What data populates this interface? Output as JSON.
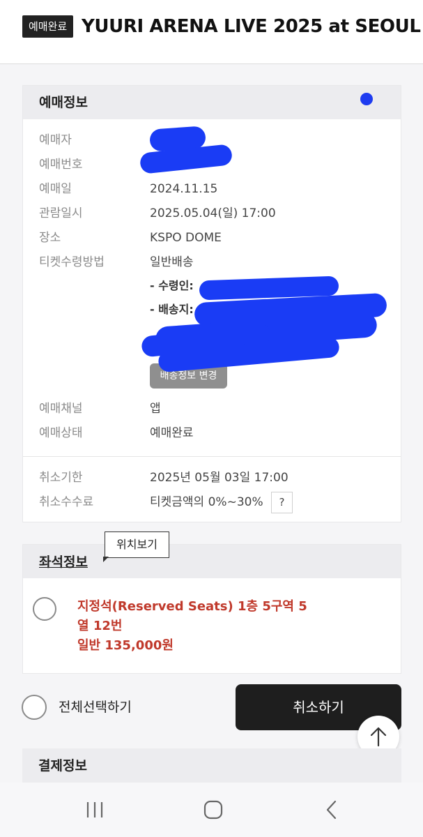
{
  "header": {
    "status_badge": "예매완료",
    "title": "YUURI ARENA LIVE 2025 at SEOUL"
  },
  "booking_info": {
    "section_title": "예매정보",
    "rows": [
      {
        "label": "예매자",
        "value": ""
      },
      {
        "label": "예매번호",
        "value": ""
      },
      {
        "label": "예매일",
        "value": "2024.11.15"
      },
      {
        "label": "관람일시",
        "value": "2025.05.04(일) 17:00"
      },
      {
        "label": "장소",
        "value": "KSPO DOME"
      },
      {
        "label": "티켓수령방법",
        "value": "일반배송"
      }
    ],
    "delivery": {
      "recipient_label": "- 수령인:",
      "address_label": "- 배송지:",
      "change_button": "배송정보 변경"
    },
    "rows_after": [
      {
        "label": "예매채널",
        "value": "앱"
      },
      {
        "label": "예매상태",
        "value": "예매완료"
      }
    ],
    "cancel_rows": [
      {
        "label": "취소기한",
        "value": "2025년 05월 03일 17:00"
      },
      {
        "label": "취소수수료",
        "value": "티켓금액의 0%~30%"
      }
    ],
    "help_button": "?"
  },
  "seat_info": {
    "section_title": "좌석정보",
    "tooltip": "위치보기",
    "seat_lines": [
      "지정석(Reserved Seats) 1층 5구역 5",
      "열 12번",
      "일반 135,000원"
    ]
  },
  "actions": {
    "select_all": "전체선택하기",
    "cancel_button": "취소하기",
    "top_icon": "arrow-up-icon"
  },
  "payment": {
    "section_title": "결제정보"
  },
  "colors": {
    "accent_red": "#c0392b",
    "redaction_blue": "#1a3cf5",
    "dark_button": "#1e1e1e"
  }
}
